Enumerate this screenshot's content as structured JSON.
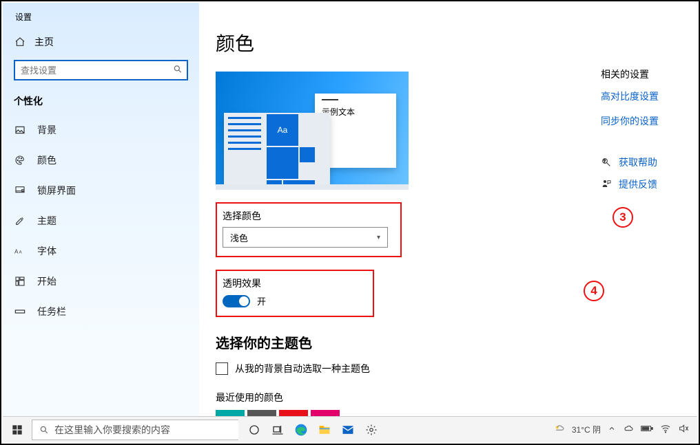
{
  "window": {
    "title": "设置"
  },
  "sidebar": {
    "home": "主页",
    "search_placeholder": "查找设置",
    "section": "个性化",
    "items": [
      {
        "label": "背景"
      },
      {
        "label": "颜色"
      },
      {
        "label": "锁屏界面"
      },
      {
        "label": "主题"
      },
      {
        "label": "字体"
      },
      {
        "label": "开始"
      },
      {
        "label": "任务栏"
      }
    ]
  },
  "page": {
    "title": "颜色",
    "preview_sample_text": "示例文本",
    "preview_tile_text": "Aa",
    "select_color_label": "选择颜色",
    "select_color_value": "浅色",
    "transparency_label": "透明效果",
    "transparency_state": "开",
    "accent_heading": "选择你的主题色",
    "auto_pick_label": "从我的背景自动选取一种主题色",
    "recent_label": "最近使用的颜色",
    "colors": [
      "#00a7a7",
      "#565656",
      "#e8111a",
      "#e2006a"
    ]
  },
  "annotations": {
    "step3": "3",
    "step4": "4"
  },
  "rail": {
    "heading": "相关的设置",
    "links": [
      "高对比度设置",
      "同步你的设置"
    ],
    "help": "获取帮助",
    "feedback": "提供反馈"
  },
  "taskbar": {
    "search_placeholder": "在这里输入你要搜索的内容",
    "weather": "31°C 阴"
  }
}
